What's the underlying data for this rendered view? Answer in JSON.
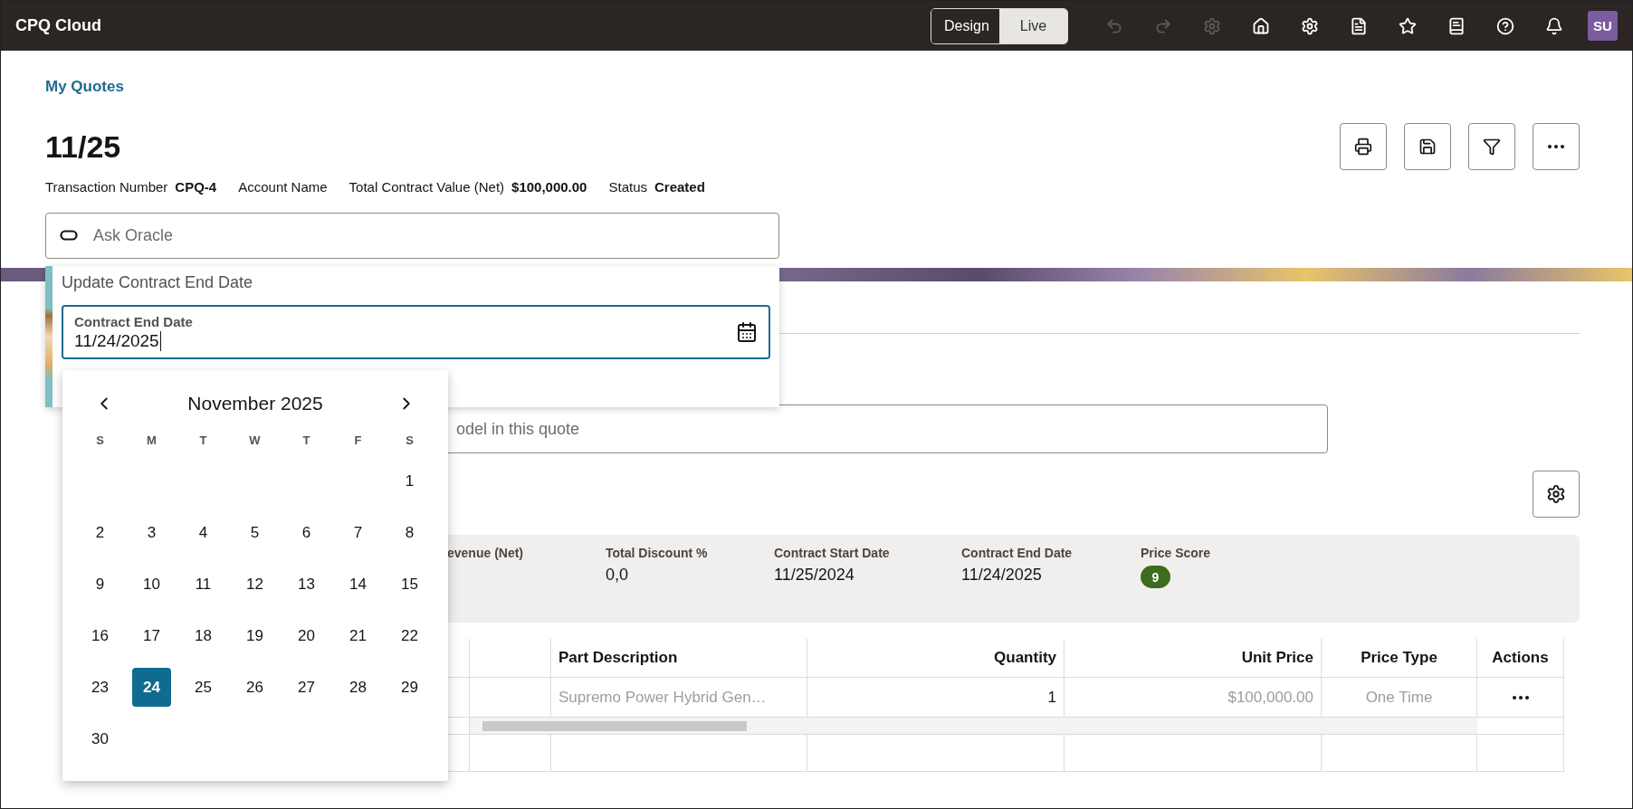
{
  "header": {
    "title": "CPQ Cloud",
    "mode_toggle": [
      {
        "label": "Design",
        "selected": false
      },
      {
        "label": "Live",
        "selected": true
      }
    ],
    "avatar": "SU"
  },
  "breadcrumb": "My Quotes",
  "quote": {
    "title": "11/25",
    "fields": [
      {
        "label": "Transaction Number",
        "value": "CPQ-4"
      },
      {
        "label": "Account Name"
      },
      {
        "label": "Total Contract Value (Net)",
        "value": "$100,000.00"
      },
      {
        "label": "Status",
        "value": "Created"
      }
    ]
  },
  "ask_field": {
    "placeholder": "Ask Oracle"
  },
  "popup": {
    "title": "Update Contract End Date",
    "date_field": {
      "label": "Contract End Date",
      "value": "11/24/2025"
    }
  },
  "calendar": {
    "month": "November 2025",
    "weekdays": [
      "S",
      "M",
      "T",
      "W",
      "T",
      "F",
      "S"
    ],
    "weeks": [
      {
        "kind": "trailing",
        "days": [
          {
            "label": "1",
            "selected": false
          }
        ]
      },
      {
        "kind": "leading",
        "days": [
          {
            "label": "2",
            "selected": false
          },
          {
            "label": "3",
            "selected": false
          },
          {
            "label": "4",
            "selected": false
          },
          {
            "label": "5",
            "selected": false
          },
          {
            "label": "6",
            "selected": false
          },
          {
            "label": "7",
            "selected": false
          },
          {
            "label": "8",
            "selected": false
          }
        ]
      },
      {
        "kind": "leading",
        "days": [
          {
            "label": "9",
            "selected": false
          },
          {
            "label": "10",
            "selected": false
          },
          {
            "label": "11",
            "selected": false
          },
          {
            "label": "12",
            "selected": false
          },
          {
            "label": "13",
            "selected": false
          },
          {
            "label": "14",
            "selected": false
          },
          {
            "label": "15",
            "selected": false
          }
        ]
      },
      {
        "kind": "leading",
        "days": [
          {
            "label": "16",
            "selected": false
          },
          {
            "label": "17",
            "selected": false
          },
          {
            "label": "18",
            "selected": false
          },
          {
            "label": "19",
            "selected": false
          },
          {
            "label": "20",
            "selected": false
          },
          {
            "label": "21",
            "selected": false
          },
          {
            "label": "22",
            "selected": false
          }
        ]
      },
      {
        "kind": "leading",
        "days": [
          {
            "label": "23",
            "selected": false
          },
          {
            "label": "24",
            "selected": true
          },
          {
            "label": "25",
            "selected": false
          },
          {
            "label": "26",
            "selected": false
          },
          {
            "label": "27",
            "selected": false
          },
          {
            "label": "28",
            "selected": false
          },
          {
            "label": "29",
            "selected": false
          }
        ]
      },
      {
        "kind": "leading",
        "days": [
          {
            "label": "30",
            "selected": false
          }
        ]
      }
    ]
  },
  "model_search": {
    "placeholder": "odel in this quote"
  },
  "summary": [
    {
      "label": "evenue (Net)"
    },
    {
      "label": "Total Discount %",
      "value": "0,0"
    },
    {
      "label": "Contract Start Date",
      "value": "11/25/2024"
    },
    {
      "label": "Contract End Date",
      "value": "11/24/2025"
    },
    {
      "label": "Price Score",
      "badge": "9",
      "color": "#3e6b1f"
    }
  ],
  "table": {
    "columns": [
      {
        "label": "Part Description",
        "kind": "text"
      },
      {
        "label": "Quantity",
        "kind": "number"
      },
      {
        "label": "Unit Price",
        "kind": "number"
      },
      {
        "label": "Price Type",
        "kind": "center"
      },
      {
        "label": "Actions",
        "kind": "center"
      }
    ],
    "rows": [
      {
        "cells": [
          "Supremo Power Hybrid Gen…",
          "1",
          "$100,000.00",
          "One Time"
        ]
      }
    ]
  }
}
